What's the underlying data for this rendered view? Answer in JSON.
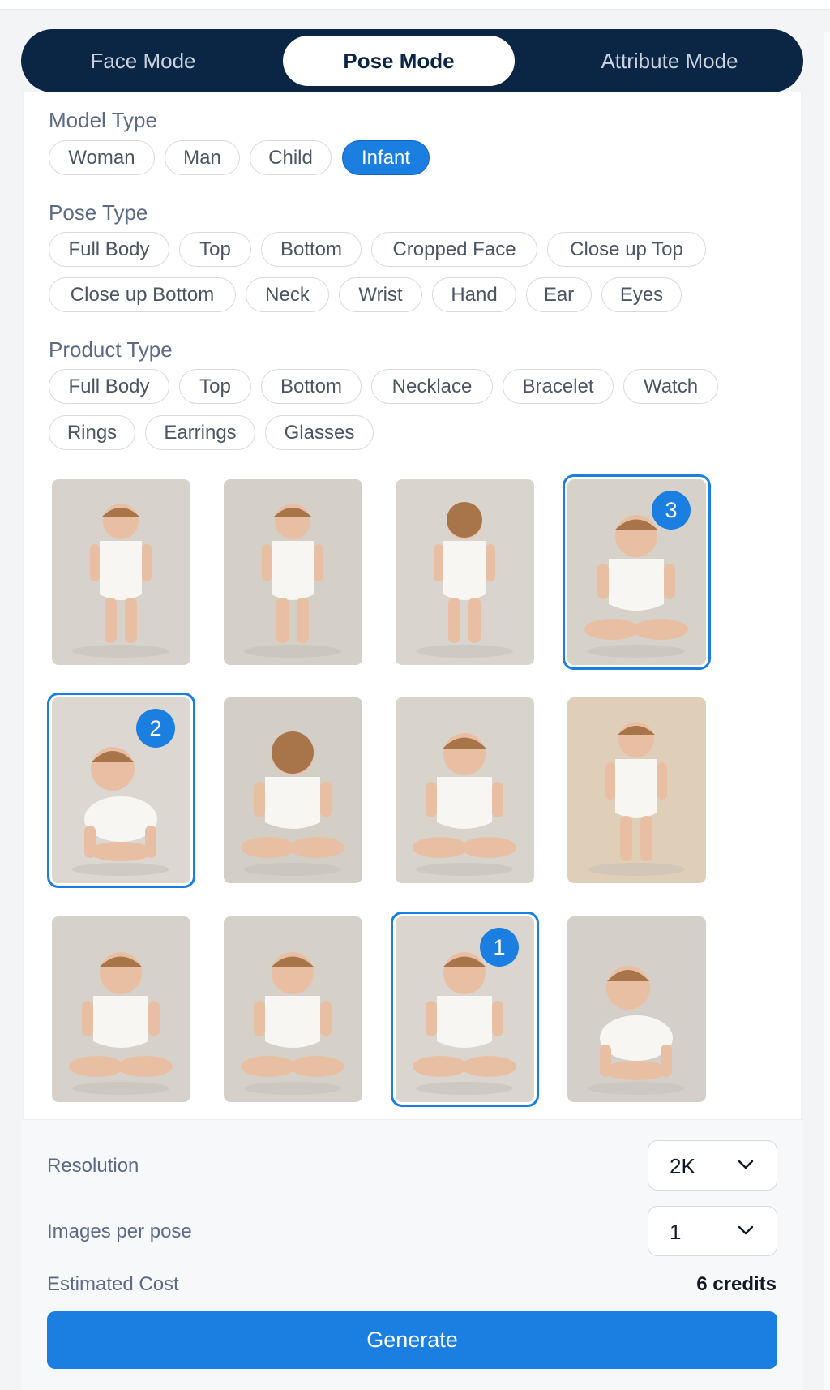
{
  "modes": [
    {
      "label": "Face Mode",
      "active": false
    },
    {
      "label": "Pose Mode",
      "active": true
    },
    {
      "label": "Attribute Mode",
      "active": false
    }
  ],
  "model_type": {
    "title": "Model Type",
    "options": [
      "Woman",
      "Man",
      "Child",
      "Infant"
    ],
    "selected": "Infant"
  },
  "pose_type": {
    "title": "Pose Type",
    "options": [
      "Full Body",
      "Top",
      "Bottom",
      "Cropped Face",
      "Close up Top",
      "Close up Bottom",
      "Neck",
      "Wrist",
      "Hand",
      "Ear",
      "Eyes"
    ]
  },
  "product_type": {
    "title": "Product Type",
    "options": [
      "Full Body",
      "Top",
      "Bottom",
      "Necklace",
      "Bracelet",
      "Watch",
      "Rings",
      "Earrings",
      "Glasses"
    ]
  },
  "poses": [
    {
      "pose": "standing-front",
      "selected_order": null
    },
    {
      "pose": "standing-front-turned",
      "selected_order": null
    },
    {
      "pose": "standing-back",
      "selected_order": null
    },
    {
      "pose": "sitting-front",
      "selected_order": "3"
    },
    {
      "pose": "crawling-front",
      "selected_order": "2"
    },
    {
      "pose": "sitting-back",
      "selected_order": null
    },
    {
      "pose": "sitting-reaching",
      "selected_order": null
    },
    {
      "pose": "standing-side",
      "selected_order": null
    },
    {
      "pose": "sitting-smiling",
      "selected_order": null
    },
    {
      "pose": "sitting-looking-up",
      "selected_order": null
    },
    {
      "pose": "sitting-looking-up-side",
      "selected_order": "1"
    },
    {
      "pose": "crawling-side",
      "selected_order": null
    }
  ],
  "settings": {
    "resolution_label": "Resolution",
    "resolution_value": "2K",
    "images_per_pose_label": "Images per pose",
    "images_per_pose_value": "1",
    "estimated_cost_label": "Estimated Cost",
    "estimated_cost_value": "6 credits",
    "generate_label": "Generate"
  },
  "colors": {
    "accent": "#1a7fe0",
    "navy": "#0b2545"
  },
  "icons": {
    "dropdown": "chevron-down-icon"
  }
}
